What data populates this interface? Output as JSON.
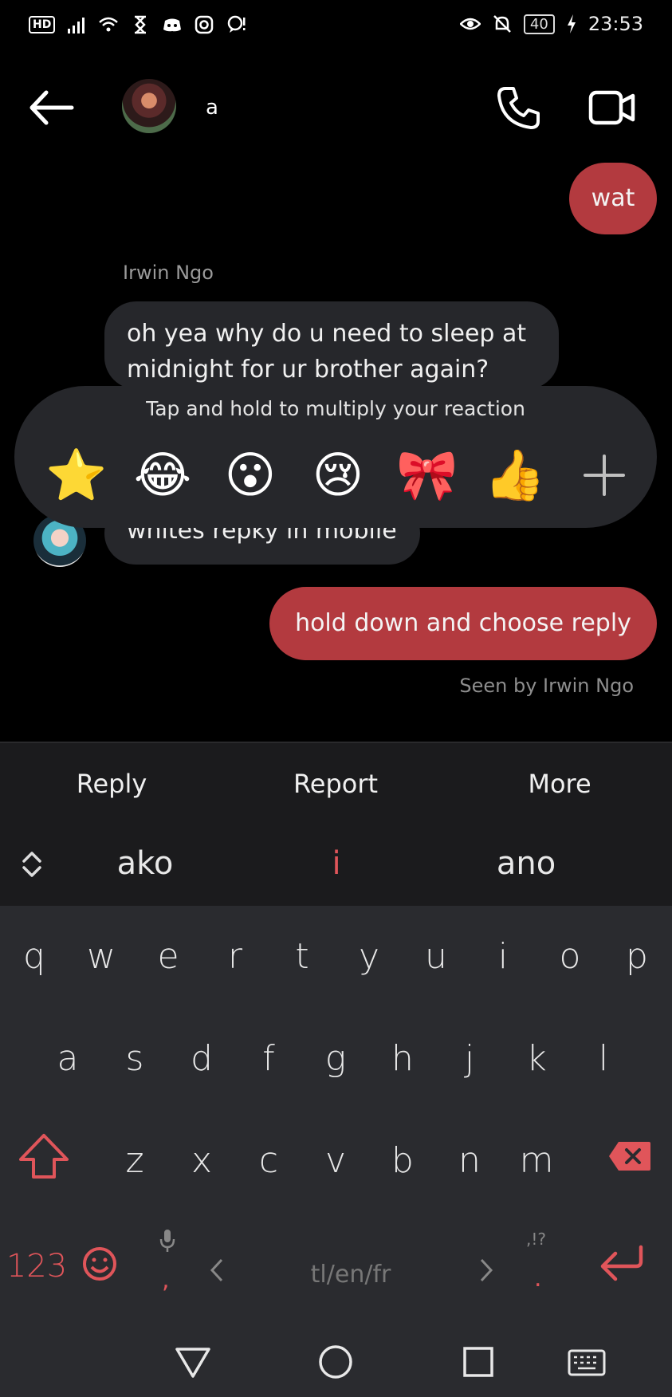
{
  "status_bar": {
    "hd_label": "HD",
    "battery": "40",
    "time": "23:53"
  },
  "header": {
    "contact_name": "a"
  },
  "messages": {
    "out_1": "wat",
    "sender_name": "Irwin Ngo",
    "in_1_line1": "oh yea why do u need to sleep at",
    "in_1_line2": "midnight for ur brother again?",
    "in_2": "whites repky in mobile",
    "out_2": "hold down and choose reply",
    "seen": "Seen by Irwin Ngo"
  },
  "reaction_panel": {
    "hint": "Tap and hold to multiply your reaction",
    "emojis": [
      "⭐",
      "😂",
      "😮",
      "😢",
      "🎀",
      "👍"
    ]
  },
  "actions": {
    "reply": "Reply",
    "report": "Report",
    "more": "More"
  },
  "suggestions": [
    "ako",
    "i",
    "ano"
  ],
  "keyboard": {
    "row1": [
      "q",
      "w",
      "e",
      "r",
      "t",
      "y",
      "u",
      "i",
      "o",
      "p"
    ],
    "row2": [
      "a",
      "s",
      "d",
      "f",
      "g",
      "h",
      "j",
      "k",
      "l"
    ],
    "row3": [
      "z",
      "x",
      "c",
      "v",
      "b",
      "n",
      "m"
    ],
    "numbers_key": "123",
    "language": "tl/en/fr",
    "punct_hint": ",!?",
    "comma": ",",
    "period": "."
  },
  "colors": {
    "accent": "#b33a3f",
    "key_red": "#e0555a",
    "bubble_in": "#26272b",
    "keyboard_bg": "#2a2b2f"
  }
}
